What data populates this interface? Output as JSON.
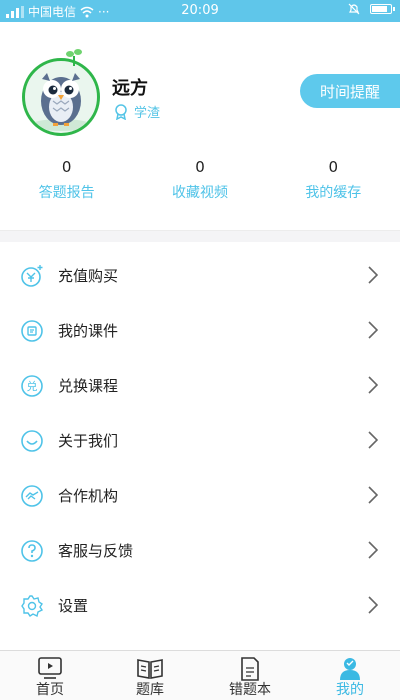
{
  "status_bar": {
    "carrier": "中国电信",
    "time": "20:09",
    "battery_level": 0.9
  },
  "profile": {
    "username": "远方",
    "level_label": "学渣",
    "reminder_button": "时间提醒"
  },
  "stats": [
    {
      "count": "0",
      "label": "答题报告"
    },
    {
      "count": "0",
      "label": "收藏视频"
    },
    {
      "count": "0",
      "label": "我的缓存"
    }
  ],
  "menu": [
    {
      "label": "充值购买",
      "icon": "recharge-yen-icon"
    },
    {
      "label": "我的课件",
      "icon": "courseware-icon"
    },
    {
      "label": "兑换课程",
      "icon": "exchange-icon"
    },
    {
      "label": "关于我们",
      "icon": "smile-icon"
    },
    {
      "label": "合作机构",
      "icon": "partner-icon"
    },
    {
      "label": "客服与反馈",
      "icon": "help-question-icon"
    },
    {
      "label": "设置",
      "icon": "gear-icon"
    }
  ],
  "tabbar": {
    "tabs": [
      {
        "label": "首页",
        "icon": "tv-icon"
      },
      {
        "label": "题库",
        "icon": "book-icon"
      },
      {
        "label": "错题本",
        "icon": "notebook-icon"
      },
      {
        "label": "我的",
        "icon": "user-icon"
      }
    ],
    "active_index": 3
  },
  "colors": {
    "accent": "#5ec9ec",
    "accent_text": "#4fc3e8",
    "avatar_ring": "#2fb64a"
  }
}
